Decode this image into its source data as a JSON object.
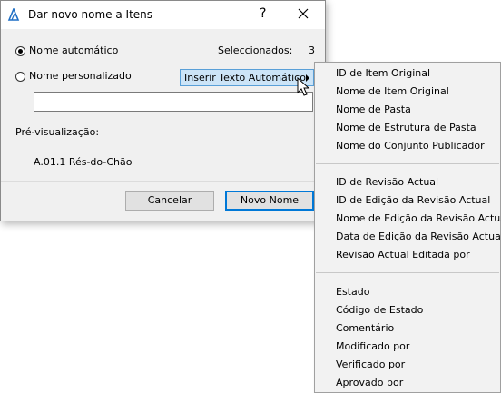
{
  "window": {
    "title": "Dar novo nome a Itens",
    "help": "?"
  },
  "options": {
    "auto_label": "Nome automático",
    "auto_selected": true,
    "custom_label": "Nome personalizado",
    "custom_selected": false,
    "selected_label": "Seleccionados:",
    "selected_count": "3",
    "custom_value": ""
  },
  "insert_button": {
    "label": "Inserir Texto Automático"
  },
  "preview": {
    "label": "Pré-visualização:",
    "value": "A.01.1 Rés-do-Chão"
  },
  "buttons": {
    "cancel": "Cancelar",
    "ok": "Novo Nome"
  },
  "menu": {
    "group1": [
      "ID de Item Original",
      "Nome de Item Original",
      "Nome de Pasta",
      "Nome de Estrutura de Pasta",
      "Nome do Conjunto Publicador"
    ],
    "group2": [
      "ID de Revisão Actual",
      "ID de Edição da Revisão Actual",
      "Nome de Edição da Revisão Actual",
      "Data de Edição da Revisão Actual",
      "Revisão Actual Editada por"
    ],
    "group3": [
      "Estado",
      "Código de Estado",
      "Comentário",
      "Modificado por",
      "Verificado por",
      "Aprovado por"
    ]
  },
  "colors": {
    "accent": "#0078d7",
    "highlight": "#cce4f7",
    "dialog_bg": "#f0f0f0"
  }
}
